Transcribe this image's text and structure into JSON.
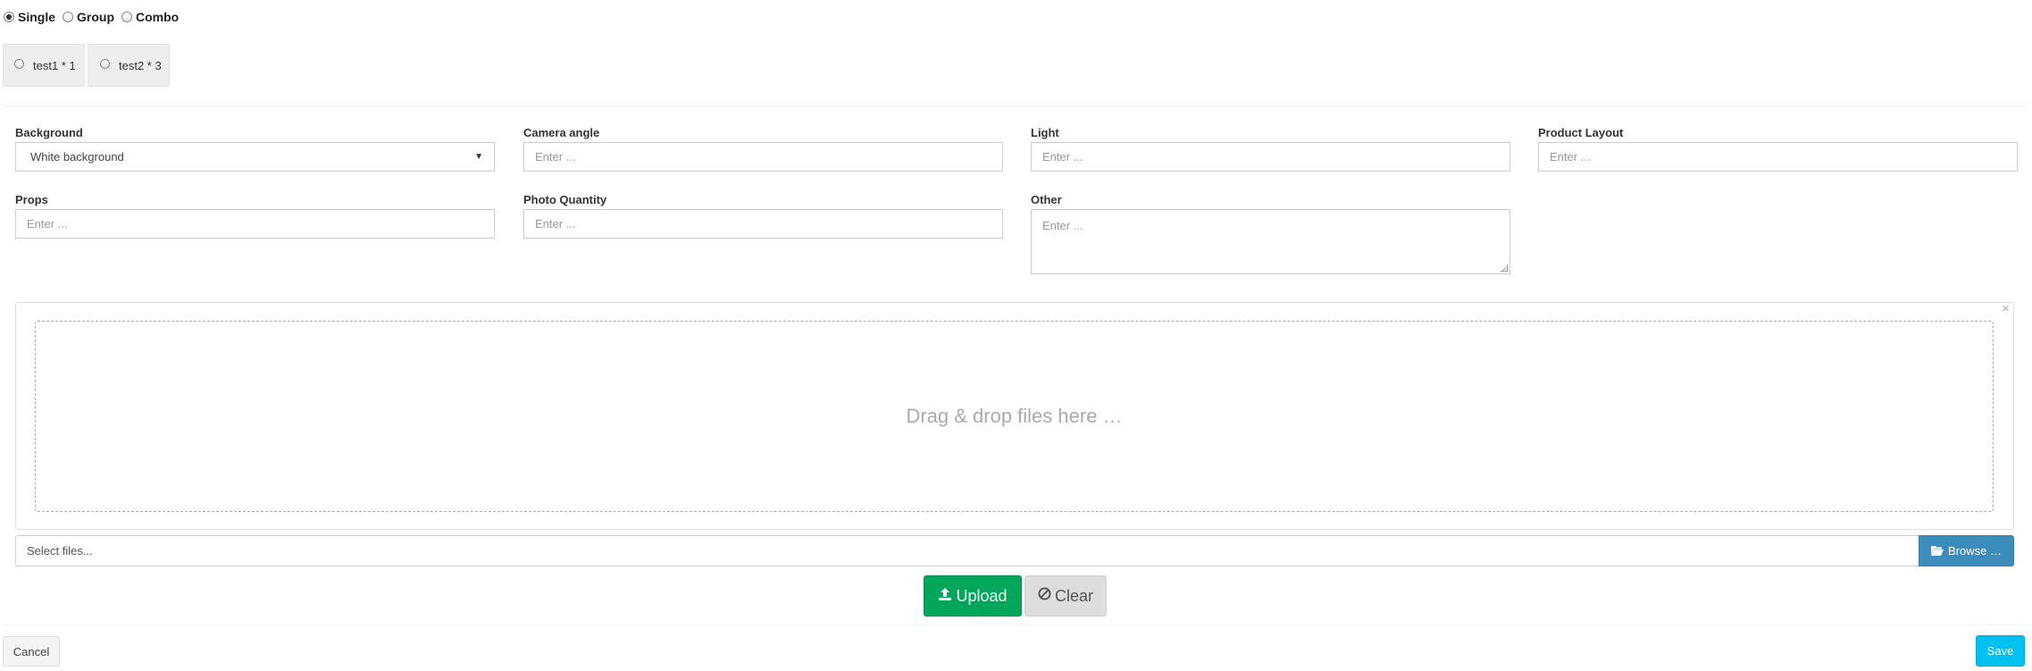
{
  "mode": {
    "options": [
      {
        "label": "Single",
        "checked": true
      },
      {
        "label": "Group",
        "checked": false
      },
      {
        "label": "Combo",
        "checked": false
      }
    ]
  },
  "variants": [
    {
      "label": "test1 * 1"
    },
    {
      "label": "test2 * 3"
    }
  ],
  "fields": {
    "background": {
      "label": "Background",
      "value": "White background"
    },
    "camera_angle": {
      "label": "Camera angle",
      "placeholder": "Enter ..."
    },
    "light": {
      "label": "Light",
      "placeholder": "Enter ..."
    },
    "product_layout": {
      "label": "Product Layout",
      "placeholder": "Enter ..."
    },
    "props": {
      "label": "Props",
      "placeholder": "Enter ..."
    },
    "photo_quantity": {
      "label": "Photo Quantity",
      "placeholder": "Enter ..."
    },
    "other": {
      "label": "Other",
      "placeholder": "Enter ..."
    }
  },
  "upload": {
    "dropzone_text": "Drag & drop files here …",
    "close_glyph": "×",
    "caption_placeholder": "Select files...",
    "browse_label": "Browse …",
    "upload_label": "Upload",
    "clear_label": "Clear"
  },
  "footer": {
    "cancel_label": "Cancel",
    "save_label": "Save"
  },
  "colors": {
    "upload_green": "#00a65a",
    "browse_blue": "#3c8dbc",
    "save_cyan": "#00c0ef"
  }
}
